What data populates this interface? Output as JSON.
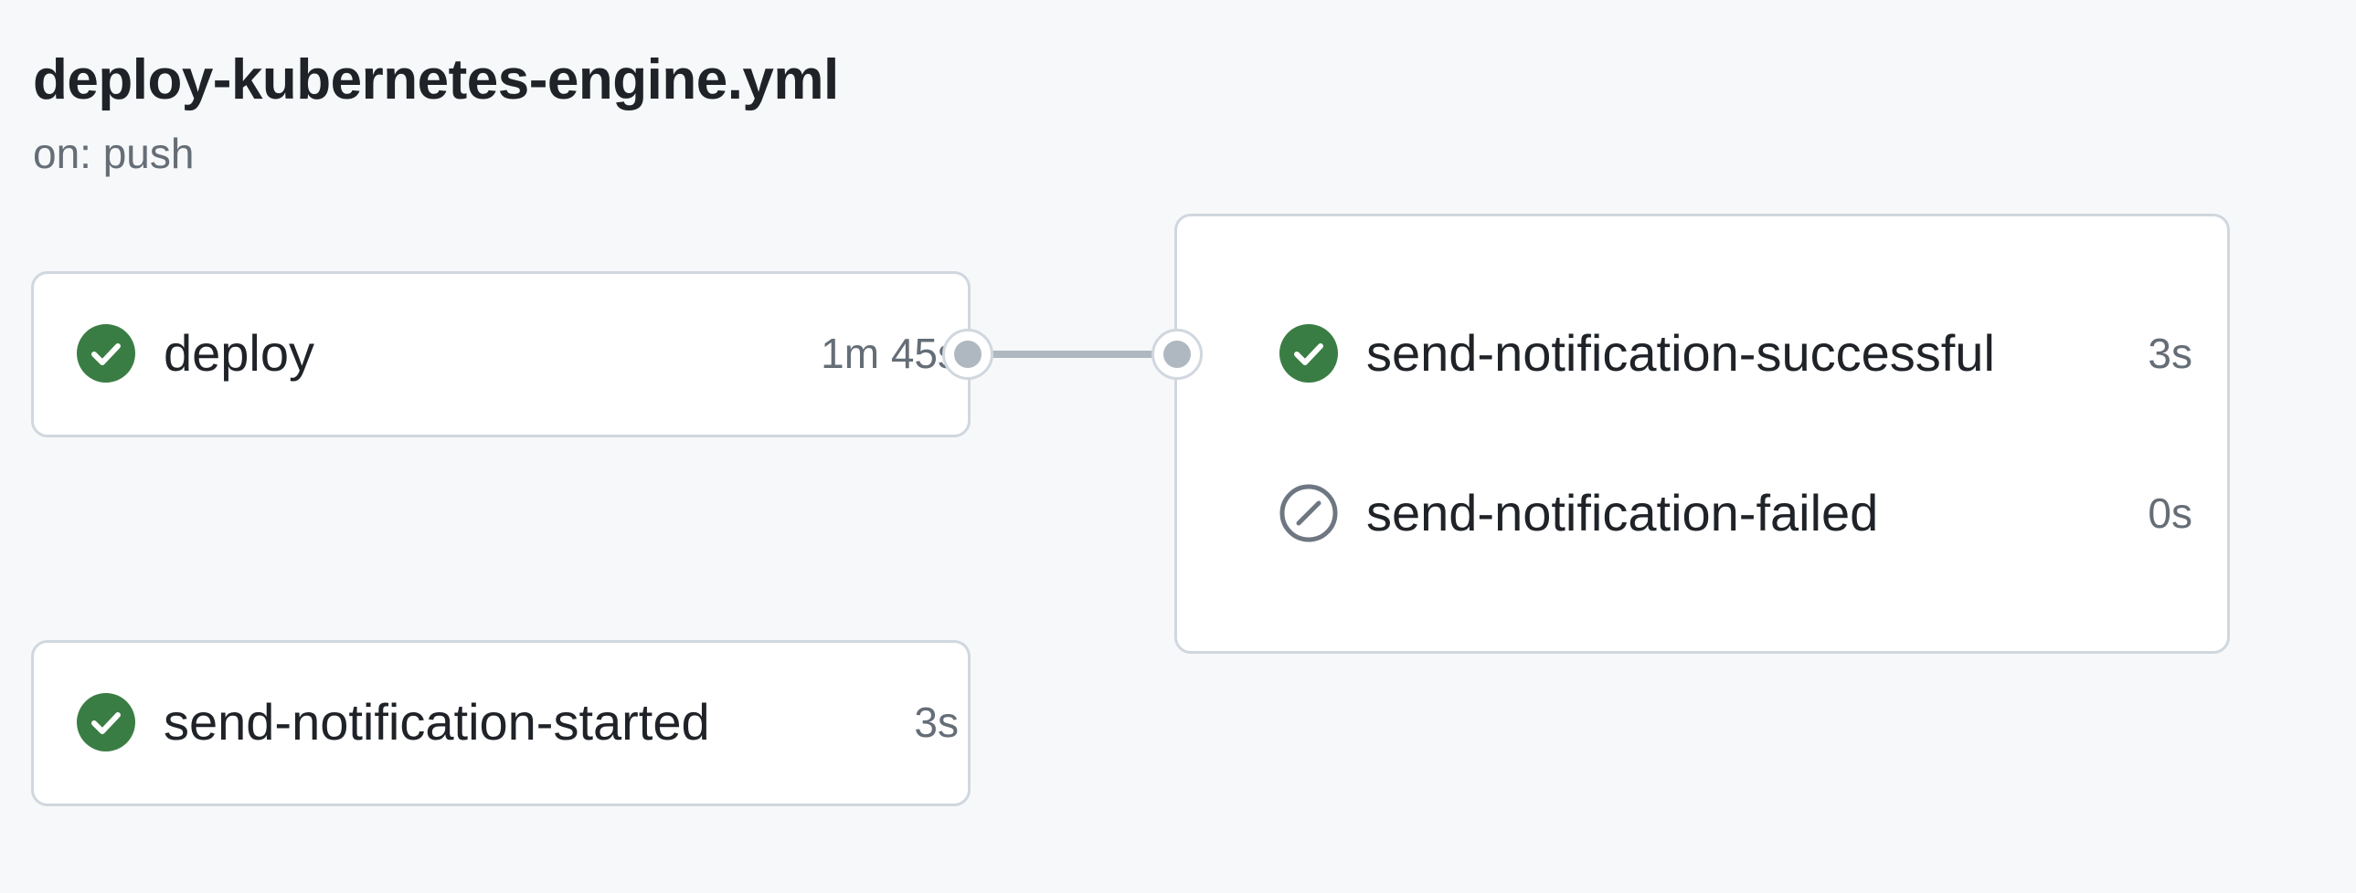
{
  "workflow": {
    "filename": "deploy-kubernetes-engine.yml",
    "trigger": "on: push"
  },
  "jobs": {
    "deploy": {
      "name": "deploy",
      "duration": "1m 45s",
      "status": "success"
    },
    "started": {
      "name": "send-notification-started",
      "duration": "3s",
      "status": "success"
    },
    "successful": {
      "name": "send-notification-successful",
      "duration": "3s",
      "status": "success"
    },
    "failed": {
      "name": "send-notification-failed",
      "duration": "0s",
      "status": "skipped"
    }
  },
  "icons": {
    "success": "check-circle-fill-icon",
    "skipped": "skip-circle-icon"
  },
  "colors": {
    "success": "#3a7d44",
    "skipped": "#6e7781",
    "border": "#d0d7de",
    "connector": "#afb8c1",
    "background": "#f6f8fa",
    "muted_text": "#656d76"
  }
}
